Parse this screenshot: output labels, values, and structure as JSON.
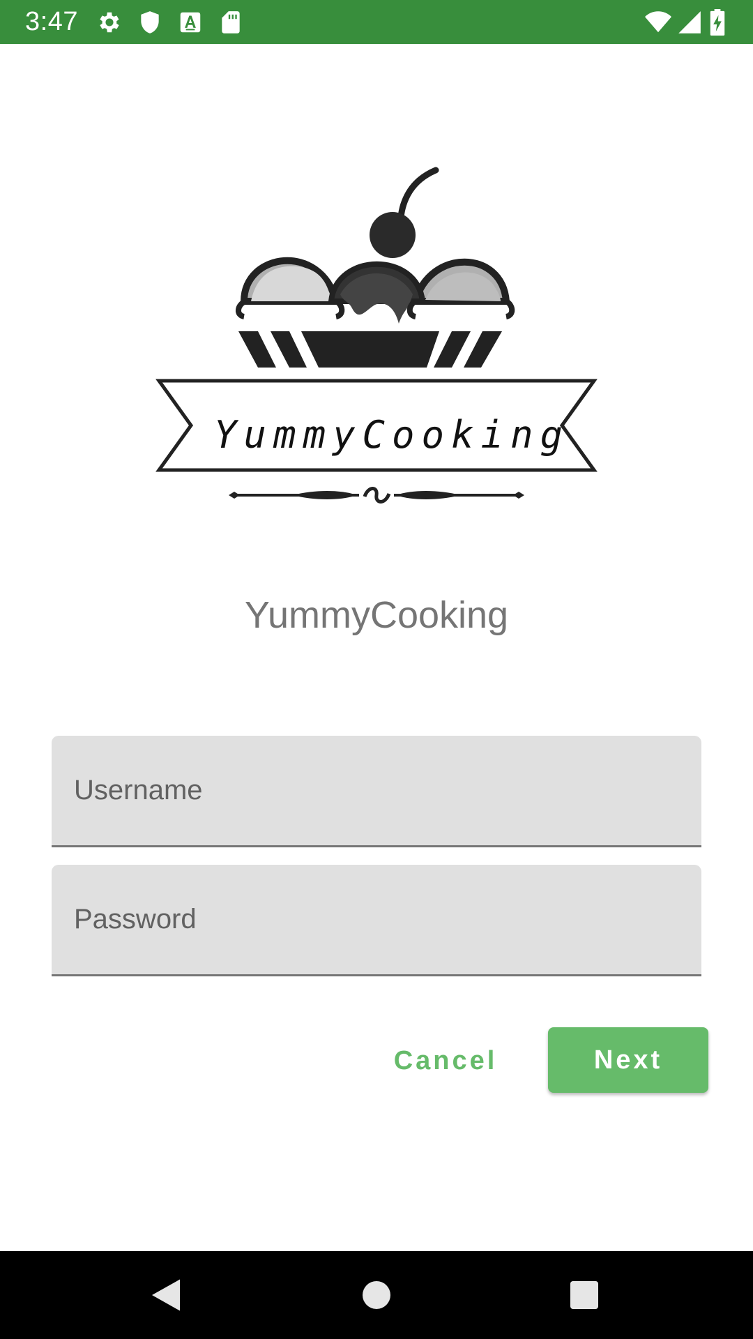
{
  "status_bar": {
    "time": "3:47",
    "background": "#388e3c",
    "left_icons": [
      "gear-icon",
      "shield-icon",
      "a-text-icon",
      "sd-card-icon"
    ],
    "right_icons": [
      "wifi-icon",
      "signal-icon",
      "battery-charging-icon"
    ]
  },
  "logo": {
    "text": "YummyCooking",
    "icon": "ice-cream-sundae-icon"
  },
  "app_title": "YummyCooking",
  "form": {
    "username": {
      "placeholder": "Username",
      "value": ""
    },
    "password": {
      "placeholder": "Password",
      "value": ""
    }
  },
  "actions": {
    "cancel_label": "Cancel",
    "next_label": "Next",
    "accent": "#66bb6a"
  },
  "nav_bar": {
    "icons": [
      "back-icon",
      "home-icon",
      "recents-icon"
    ]
  }
}
